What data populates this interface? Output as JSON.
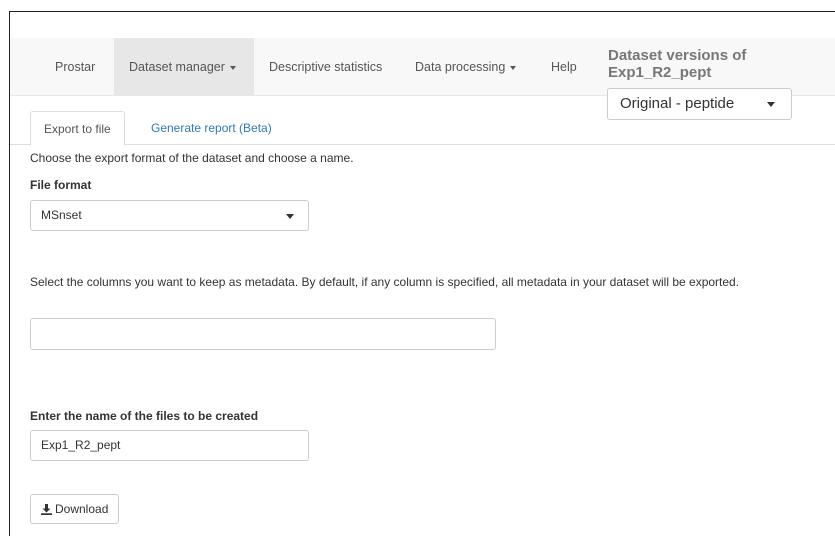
{
  "navbar": {
    "items": [
      {
        "label": "Prostar"
      },
      {
        "label": "Dataset manager"
      },
      {
        "label": "Descriptive statistics"
      },
      {
        "label": "Data processing"
      },
      {
        "label": "Help"
      }
    ],
    "title": "Dataset versions of Exp1_R2_pept"
  },
  "version_select": {
    "value": "Original - peptide"
  },
  "tabs": [
    {
      "label": "Export to file"
    },
    {
      "label": "Generate report (Beta)"
    }
  ],
  "export": {
    "intro": "Choose the export format of the dataset and choose a name.",
    "format_label": "File format",
    "format_value": "MSnset",
    "metadata_text": "Select the columns you want to keep as metadata. By default, if any column is specified, all metadata in your dataset will be exported.",
    "metadata_value": "",
    "filename_label": "Enter the name of the files to be created",
    "filename_value": "Exp1_R2_pept",
    "download_label": "Download"
  },
  "icons": {
    "download": "download-icon",
    "caret": "chevron-down-icon"
  }
}
